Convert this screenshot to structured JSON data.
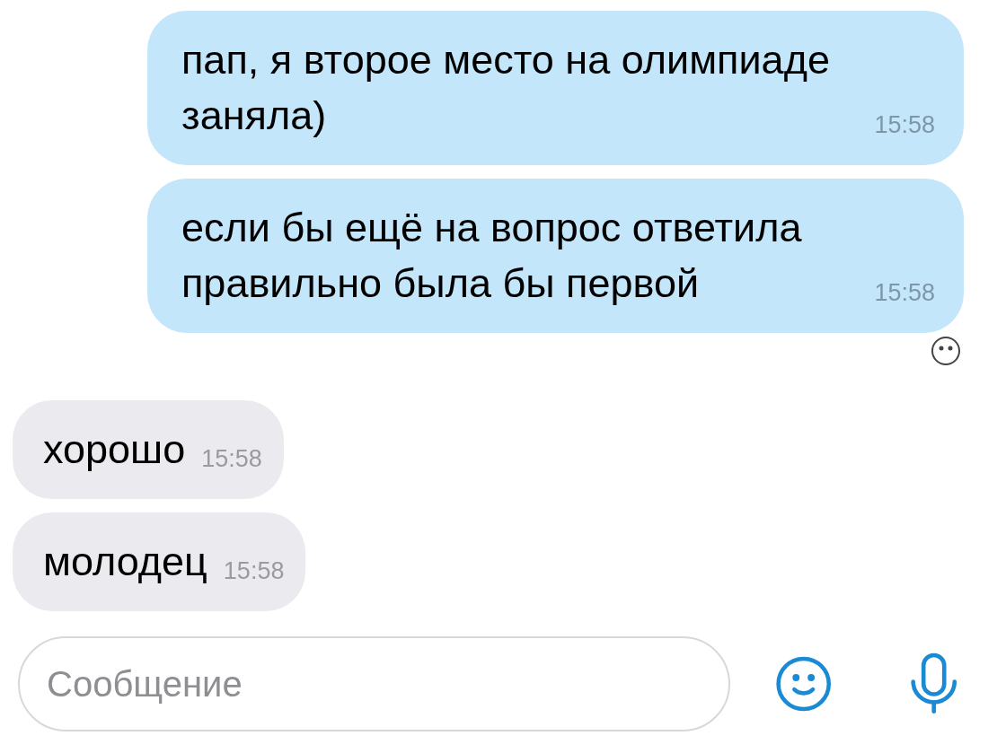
{
  "messages": [
    {
      "kind": "outgoing",
      "text": "пап, я второе место на олимпиаде заняла)",
      "time": "15:58",
      "read": false
    },
    {
      "kind": "outgoing",
      "text": "если бы ещё на вопрос ответила правильно была бы первой",
      "time": "15:58",
      "read": true
    },
    {
      "kind": "incoming",
      "text": "хорошо",
      "time": "15:58",
      "read": false
    },
    {
      "kind": "incoming",
      "text": "молодец",
      "time": "15:58",
      "read": false
    }
  ],
  "composer": {
    "placeholder": "Сообщение"
  }
}
